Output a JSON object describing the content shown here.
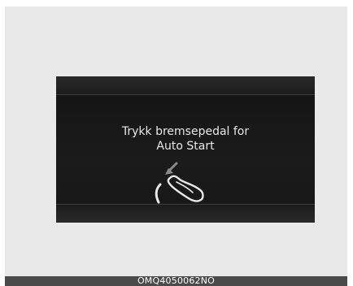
{
  "display": {
    "message_line1": "Trykk bremsepedal for",
    "message_line2": "Auto Start",
    "icon": "brake-pedal-foot-icon"
  },
  "figure": {
    "code": "OMQ4050062NO"
  },
  "colors": {
    "background": "#e9e9e9",
    "display": "#1e1e1e",
    "text": "#e8e8e8",
    "arrow": "#888888",
    "code_bar": "#4a4a4a"
  }
}
